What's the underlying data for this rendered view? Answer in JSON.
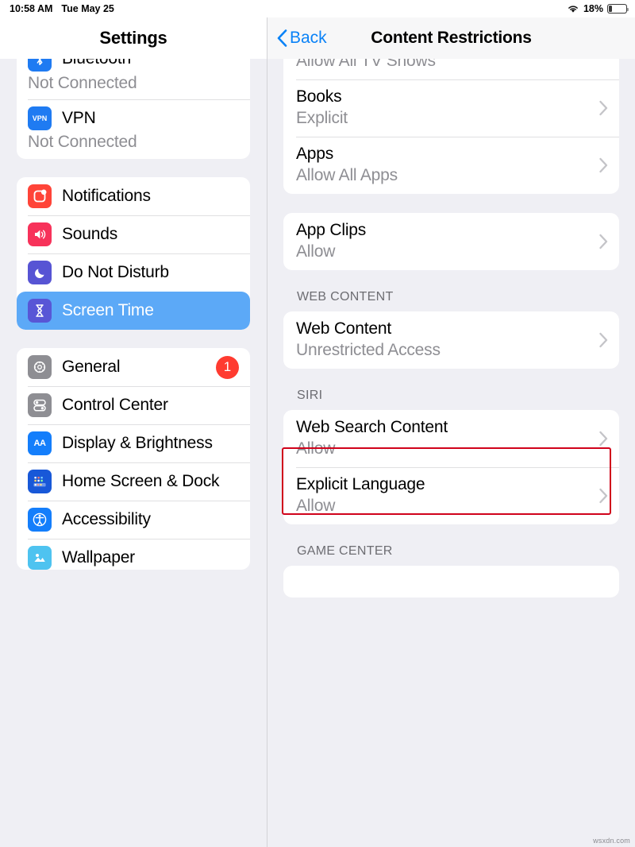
{
  "status_bar": {
    "time": "10:58 AM",
    "date": "Tue May 25",
    "wifi_icon": "wifi-icon",
    "battery_percent": "18%",
    "battery_icon": "battery-icon"
  },
  "sidebar": {
    "title": "Settings",
    "groups": [
      {
        "clipped_top": true,
        "items": [
          {
            "label": "Bluetooth",
            "sublabel": "Not Connected",
            "icon": "bluetooth-icon",
            "icon_color": "#1f7bf2",
            "clipped": true
          },
          {
            "label": "VPN",
            "sublabel": "Not Connected",
            "icon": "vpn-icon",
            "icon_color": "#1f7bf2"
          }
        ]
      },
      {
        "clipped_top": false,
        "items": [
          {
            "label": "Notifications",
            "icon": "notifications-icon",
            "icon_color": "#FF4438"
          },
          {
            "label": "Sounds",
            "icon": "sounds-icon",
            "icon_color": "#F7325A"
          },
          {
            "label": "Do Not Disturb",
            "icon": "moon-icon",
            "icon_color": "#5754D4"
          },
          {
            "label": "Screen Time",
            "icon": "hourglass-icon",
            "icon_color": "#5856D6",
            "selected": true
          }
        ]
      },
      {
        "clipped_top": false,
        "items": [
          {
            "label": "General",
            "icon": "gear-icon",
            "icon_color": "#8E8E93",
            "badge": "1"
          },
          {
            "label": "Control Center",
            "icon": "control-center-icon",
            "icon_color": "#8E8E93"
          },
          {
            "label": "Display & Brightness",
            "icon": "display-brightness-icon",
            "icon_color": "#147EFB"
          },
          {
            "label": "Home Screen & Dock",
            "icon": "home-screen-dock-icon",
            "icon_color": "#1858D8"
          },
          {
            "label": "Accessibility",
            "icon": "accessibility-icon",
            "icon_color": "#147EFB"
          },
          {
            "label": "Wallpaper",
            "icon": "wallpaper-icon",
            "icon_color": "#4EC3F0",
            "clipped_bottom": true
          }
        ]
      }
    ]
  },
  "detail": {
    "back_label": "Back",
    "title": "Content Restrictions",
    "sections": [
      {
        "header": "",
        "clipped_top": true,
        "rows": [
          {
            "title": "",
            "sublabel": "Allow All TV Shows",
            "clipped": true,
            "chevron": false
          },
          {
            "title": "Books",
            "sublabel": "Explicit",
            "chevron": true
          },
          {
            "title": "Apps",
            "sublabel": "Allow All Apps",
            "chevron": true
          }
        ]
      },
      {
        "header": "",
        "rows": [
          {
            "title": "App Clips",
            "sublabel": "Allow",
            "chevron": true
          }
        ]
      },
      {
        "header": "WEB CONTENT",
        "rows": [
          {
            "title": "Web Content",
            "sublabel": "Unrestricted Access",
            "chevron": true,
            "highlighted": true
          }
        ]
      },
      {
        "header": "SIRI",
        "rows": [
          {
            "title": "Web Search Content",
            "sublabel": "Allow",
            "chevron": true
          },
          {
            "title": "Explicit Language",
            "sublabel": "Allow",
            "chevron": true
          }
        ]
      },
      {
        "header": "GAME CENTER",
        "rows": []
      }
    ]
  },
  "annotation": {
    "color": "#D0021B",
    "target": "Web Content"
  },
  "watermark": "wsxdn.com"
}
